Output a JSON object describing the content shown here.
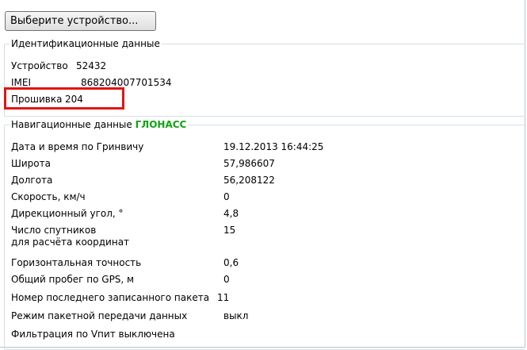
{
  "device_button": {
    "label": "Выберите устройство..."
  },
  "identification": {
    "title": "Идентификационные данные",
    "device": {
      "label": "Устройство",
      "value": "52432"
    },
    "imei": {
      "label": "IMEI",
      "value": "868204007701534"
    },
    "firmware": {
      "label": "Прошивка",
      "value": "204"
    }
  },
  "navigation": {
    "title_prefix": "Навигационные данные",
    "title_system": "ГЛОНАСС",
    "rows": [
      {
        "label": "Дата и время по Гринвичу",
        "value": "19.12.2013 16:44:25"
      },
      {
        "label": "Широта",
        "value": "57,986607"
      },
      {
        "label": "Долгота",
        "value": "56,208122"
      },
      {
        "label": "Скорость, км/ч",
        "value": "0"
      },
      {
        "label": "Дирекционный угол, °",
        "value": "4,8"
      },
      {
        "label": "Число спутников",
        "label2": "для расчёта координат",
        "value": "15"
      },
      {
        "label": "Горизонтальная точность",
        "value": "0,6"
      },
      {
        "label": "Общий пробег по GPS, м",
        "value": "0"
      },
      {
        "label": "Номер последнего записанного пакета",
        "value": "11"
      },
      {
        "label": "Режим пакетной передачи данных",
        "value": "выкл"
      },
      {
        "label": "Фильтрация по Vпит выключена"
      }
    ]
  },
  "colors": {
    "highlight": "#e01515",
    "glonass": "#11a311",
    "group_border": "#d5dfe5"
  }
}
